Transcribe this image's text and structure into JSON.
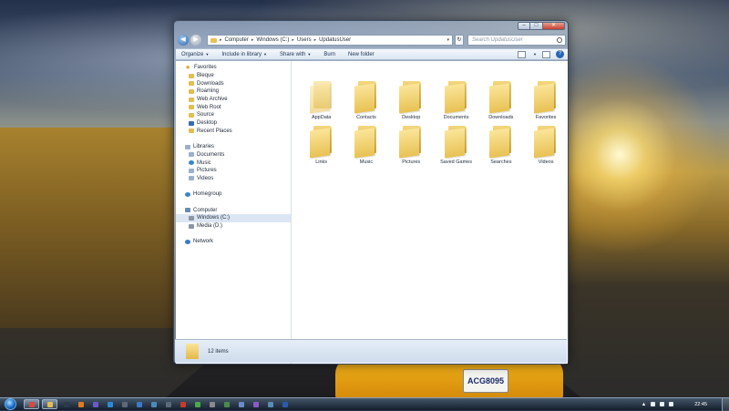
{
  "window": {
    "controls": [
      "–",
      "□",
      "✕"
    ],
    "address": {
      "crumbs": [
        "Computer",
        "Windows (C:)",
        "Users",
        "UpdatusUser"
      ],
      "search_placeholder": "Search UpdatusUser"
    },
    "toolbar": {
      "organize": "Organize",
      "include_in_library": "Include in library",
      "share_with": "Share with",
      "burn": "Burn",
      "new_folder": "New folder"
    },
    "sidebar": [
      {
        "label": "Favorites",
        "icon": "star-icon",
        "level": 0
      },
      {
        "label": "Bleque",
        "icon": "folder-icon",
        "level": 1
      },
      {
        "label": "Downloads",
        "icon": "folder-icon",
        "level": 1
      },
      {
        "label": "Roaming",
        "icon": "folder-icon",
        "level": 1
      },
      {
        "label": "Web Archive",
        "icon": "folder-icon",
        "level": 1
      },
      {
        "label": "Web Root",
        "icon": "folder-icon",
        "level": 1
      },
      {
        "label": "Source",
        "icon": "folder-icon",
        "level": 1
      },
      {
        "label": "Desktop",
        "icon": "desktop-icon",
        "level": 1
      },
      {
        "label": "Recent Places",
        "icon": "recent-places-icon",
        "level": 1
      },
      {
        "gap": true
      },
      {
        "label": "Libraries",
        "icon": "libraries-icon",
        "level": 0
      },
      {
        "label": "Documents",
        "icon": "documents-icon",
        "level": 1
      },
      {
        "label": "Music",
        "icon": "music-icon",
        "level": 1
      },
      {
        "label": "Pictures",
        "icon": "pictures-icon",
        "level": 1
      },
      {
        "label": "Videos",
        "icon": "videos-icon",
        "level": 1
      },
      {
        "gap": true
      },
      {
        "label": "Homegroup",
        "icon": "homegroup-icon",
        "level": 0
      },
      {
        "gap": true
      },
      {
        "label": "Computer",
        "icon": "computer-icon",
        "level": 0
      },
      {
        "label": "Windows (C:)",
        "icon": "drive-icon",
        "level": 1,
        "selected": true
      },
      {
        "label": "Media (D:)",
        "icon": "drive-icon",
        "level": 1
      },
      {
        "gap": true
      },
      {
        "label": "Network",
        "icon": "network-icon",
        "level": 0
      }
    ],
    "folders": [
      {
        "name": "AppData",
        "hidden": true
      },
      {
        "name": "Contacts"
      },
      {
        "name": "Desktop"
      },
      {
        "name": "Documents"
      },
      {
        "name": "Downloads"
      },
      {
        "name": "Favorites"
      },
      {
        "name": "Links"
      },
      {
        "name": "Music"
      },
      {
        "name": "Pictures"
      },
      {
        "name": "Saved Games"
      },
      {
        "name": "Searches"
      },
      {
        "name": "Videos"
      }
    ],
    "status": "12 items"
  },
  "taskbar": {
    "apps": [
      {
        "icon": "chrome-icon",
        "color": "#d84a3a",
        "active": true
      },
      {
        "icon": "explorer-icon",
        "color": "#e2bd52",
        "active": true
      },
      {
        "icon": "media-icon",
        "color": "#2a3a4a"
      },
      {
        "icon": "illustrator-icon",
        "color": "#e07a20"
      },
      {
        "icon": "after-effects-icon",
        "color": "#6a5ac8"
      },
      {
        "icon": "photoshop-icon",
        "color": "#2a8ad8"
      },
      {
        "icon": "app-icon",
        "color": "#5a6a7a"
      },
      {
        "icon": "app-icon",
        "color": "#3a7ac8"
      },
      {
        "icon": "app-icon",
        "color": "#4a8ab8"
      },
      {
        "icon": "app-icon",
        "color": "#5a6a7a"
      },
      {
        "icon": "app-icon",
        "color": "#c83a2a"
      },
      {
        "icon": "app-icon",
        "color": "#4aa84a"
      },
      {
        "icon": "app-icon",
        "color": "#8a8a8a"
      },
      {
        "icon": "app-icon",
        "color": "#4a8a4a"
      },
      {
        "icon": "app-icon",
        "color": "#6a8ac8"
      },
      {
        "icon": "app-icon",
        "color": "#8a5ac8"
      },
      {
        "icon": "app-icon",
        "color": "#5a8ab8"
      },
      {
        "icon": "word-icon",
        "color": "#2a5ab0"
      }
    ],
    "clock": "22:45"
  },
  "wallpaper": {
    "plate": "ACG8095"
  }
}
